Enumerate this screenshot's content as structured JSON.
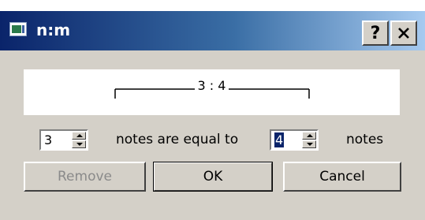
{
  "window": {
    "title": "n:m",
    "help_label": "?",
    "close_icon": "close-icon",
    "app_icon": "app-icon"
  },
  "preview": {
    "ratio_text": "3 : 4"
  },
  "ratio": {
    "left_value": "3",
    "middle_text": "notes are equal to",
    "right_value": "4",
    "right_text": "notes"
  },
  "buttons": {
    "remove": "Remove",
    "ok": "OK",
    "cancel": "Cancel"
  },
  "colors": {
    "title_gradient_start": "#0a246a",
    "title_gradient_end": "#a6caf0",
    "dialog_bg": "#d4d0c8",
    "selection": "#0a246a"
  }
}
